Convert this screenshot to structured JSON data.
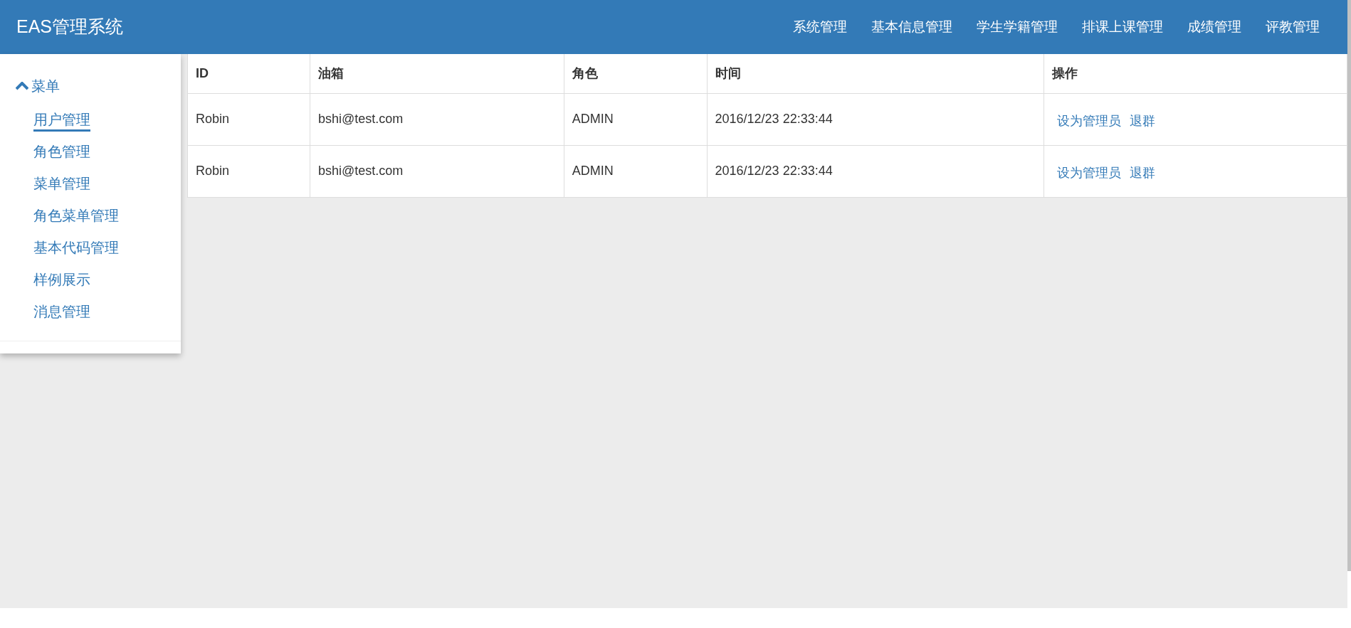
{
  "navbar": {
    "brand": "EAS管理系统",
    "items": [
      {
        "label": "系统管理"
      },
      {
        "label": "基本信息管理"
      },
      {
        "label": "学生学籍管理"
      },
      {
        "label": "排课上课管理"
      },
      {
        "label": "成绩管理"
      },
      {
        "label": "评教管理"
      }
    ]
  },
  "sidebar": {
    "heading": "菜单",
    "expanded": true,
    "items": [
      {
        "label": "用户管理",
        "selected": true
      },
      {
        "label": "角色管理",
        "selected": false
      },
      {
        "label": "菜单管理",
        "selected": false
      },
      {
        "label": "角色菜单管理",
        "selected": false
      },
      {
        "label": "基本代码管理",
        "selected": false
      },
      {
        "label": "样例展示",
        "selected": false
      },
      {
        "label": "消息管理",
        "selected": false
      }
    ]
  },
  "table": {
    "columns": [
      "ID",
      "油箱",
      "角色",
      "时间",
      "操作"
    ],
    "rows": [
      {
        "cells": [
          "Robin",
          "bshi@test.com",
          "ADMIN",
          "2016/12/23 22:33:44"
        ],
        "actions": [
          "设为管理员",
          "退群"
        ]
      },
      {
        "cells": [
          "Robin",
          "bshi@test.com",
          "ADMIN",
          "2016/12/23 22:33:44"
        ],
        "actions": [
          "设为管理员",
          "退群"
        ]
      }
    ]
  }
}
